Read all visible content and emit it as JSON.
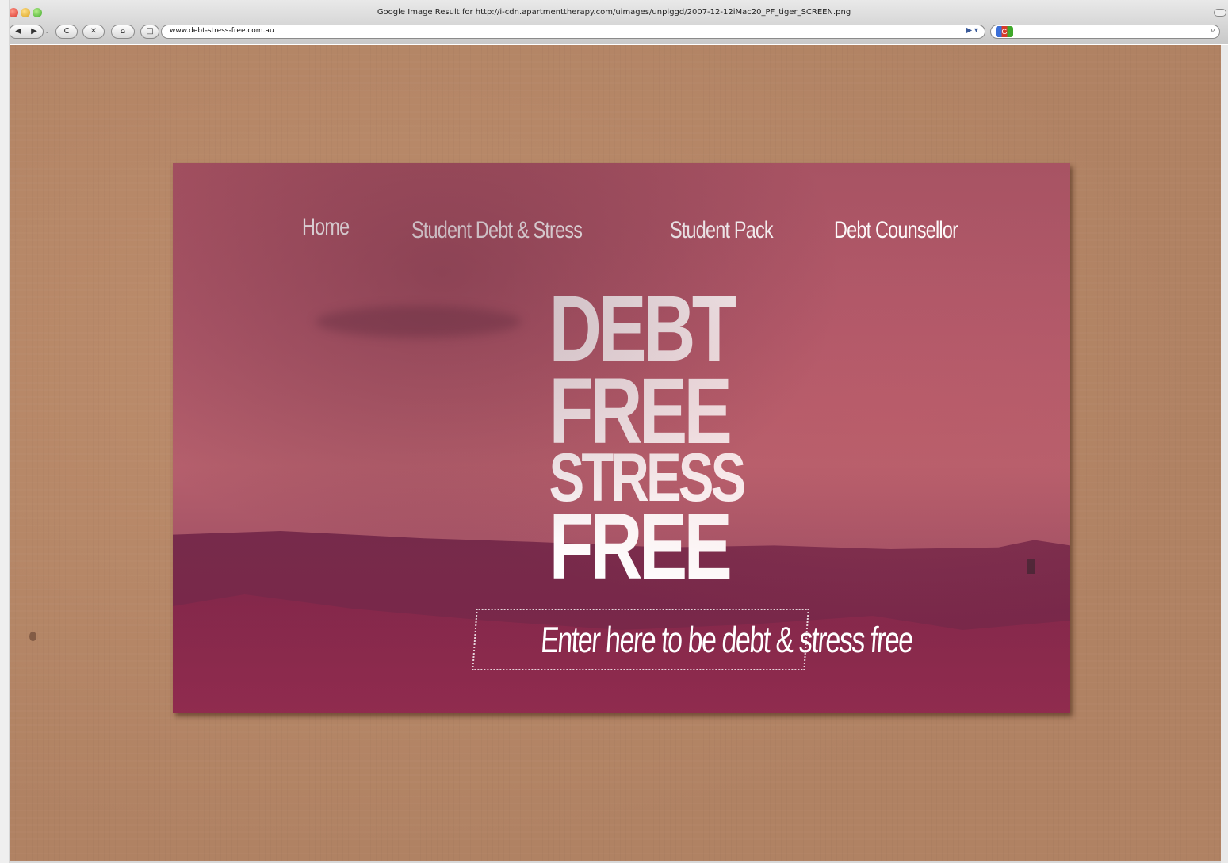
{
  "browser": {
    "window_title": "Google Image Result for http://i-cdn.apartmenttherapy.com/uimages/unplggd/2007-12-12iMac20_PF_tiger_SCREEN.png",
    "address": "www.debt-stress-free.com.au",
    "search_value": "",
    "buttons": {
      "back": "◀",
      "forward": "▶",
      "reload": "C",
      "stop": "✕",
      "home": "⌂",
      "bookmark": "□",
      "rss": "▶ ▾",
      "search": "⌕"
    }
  },
  "site": {
    "nav": [
      "Home",
      "Student Debt & Stress",
      "Student Pack",
      "Debt Counsellor"
    ],
    "hero": [
      "DEBT",
      "FREE",
      "STRESS",
      "FREE"
    ],
    "cta": "Enter here to be debt & stress free"
  },
  "colors": {
    "background_cardboard": "#b5866a",
    "card_top": "#a85363",
    "card_bottom": "#7c2f52",
    "text": "#ffffff"
  }
}
